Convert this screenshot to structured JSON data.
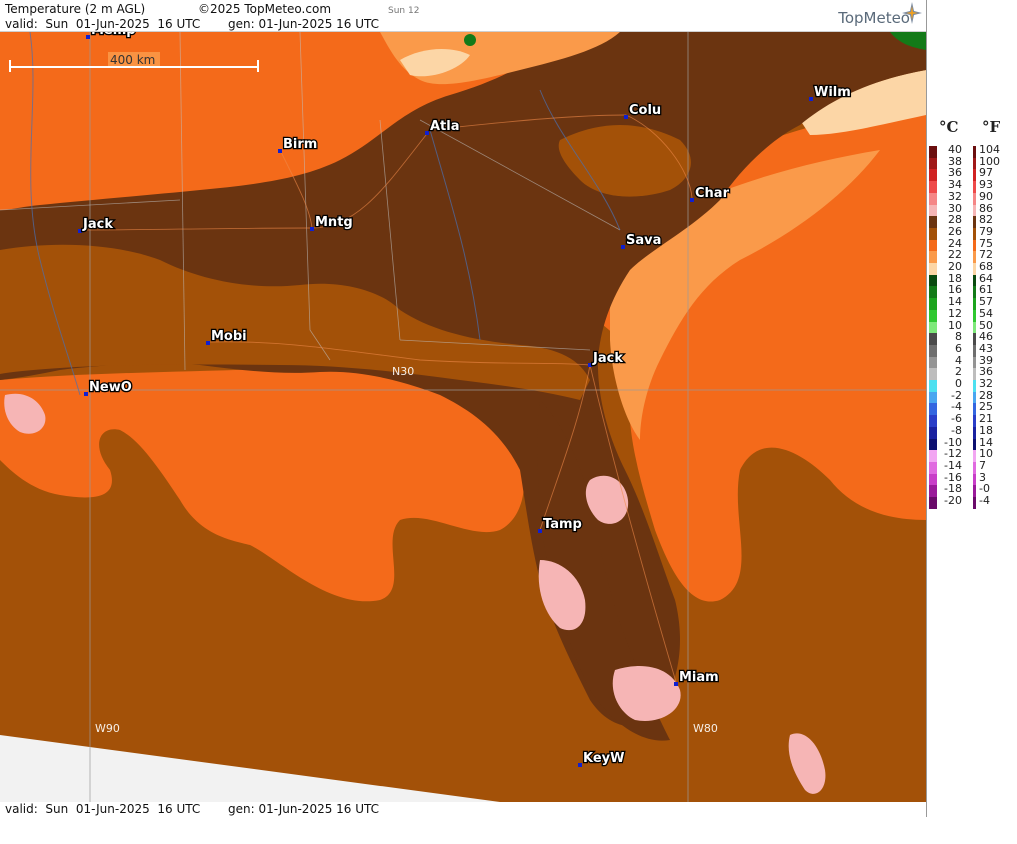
{
  "header": {
    "title": "Temperature (2 m AGL)",
    "copyright": "©2025 TopMeteo.com",
    "day_code": "Sun 12",
    "valid_line": "valid:  Sun  01-Jun-2025  16 UTC",
    "gen_line": "gen: 01-Jun-2025 16 UTC",
    "logo": "TopMeteo"
  },
  "footer": {
    "valid_line": "valid:  Sun  01-Jun-2025  16 UTC",
    "gen_line": "gen: 01-Jun-2025 16 UTC"
  },
  "scale_bar": {
    "label": "400 km"
  },
  "grid_labels": {
    "lat_n30": "N30",
    "lon_w90": "W90",
    "lon_w80": "W80"
  },
  "cities": [
    {
      "id": "memphis",
      "label": "Memp"
    },
    {
      "id": "birmingham",
      "label": "Birm"
    },
    {
      "id": "atlanta",
      "label": "Atla"
    },
    {
      "id": "columbia",
      "label": "Colu"
    },
    {
      "id": "wilmington",
      "label": "Wilm"
    },
    {
      "id": "jackson-ms",
      "label": "Jack"
    },
    {
      "id": "montgomery",
      "label": "Mntg"
    },
    {
      "id": "charleston",
      "label": "Char"
    },
    {
      "id": "savannah",
      "label": "Sava"
    },
    {
      "id": "mobile",
      "label": "Mobi"
    },
    {
      "id": "jacksonville",
      "label": "Jack"
    },
    {
      "id": "new-orleans",
      "label": "NewO"
    },
    {
      "id": "tampa",
      "label": "Tamp"
    },
    {
      "id": "miami",
      "label": "Miam"
    },
    {
      "id": "key-west",
      "label": "KeyW"
    }
  ],
  "legend": {
    "celsius_header": "°C",
    "fahrenheit_header": "°F",
    "rows": [
      {
        "c": "40",
        "f": "104",
        "color": "#6b0f0f"
      },
      {
        "c": "38",
        "f": "100",
        "color": "#a01818"
      },
      {
        "c": "36",
        "f": "97",
        "color": "#d02222"
      },
      {
        "c": "34",
        "f": "93",
        "color": "#ee4a4a"
      },
      {
        "c": "32",
        "f": "90",
        "color": "#f58686"
      },
      {
        "c": "30",
        "f": "86",
        "color": "#f6b5b5"
      },
      {
        "c": "28",
        "f": "82",
        "color": "#6b3410"
      },
      {
        "c": "26",
        "f": "79",
        "color": "#a35108"
      },
      {
        "c": "24",
        "f": "75",
        "color": "#f46a1a"
      },
      {
        "c": "22",
        "f": "72",
        "color": "#fa9a4a"
      },
      {
        "c": "20",
        "f": "68",
        "color": "#fcd6a6"
      },
      {
        "c": "18",
        "f": "64",
        "color": "#0a4a10"
      },
      {
        "c": "16",
        "f": "61",
        "color": "#137a18"
      },
      {
        "c": "14",
        "f": "57",
        "color": "#1ca41e"
      },
      {
        "c": "12",
        "f": "54",
        "color": "#2fc830"
      },
      {
        "c": "10",
        "f": "50",
        "color": "#7ee87a"
      },
      {
        "c": "8",
        "f": "46",
        "color": "#4a4a4a"
      },
      {
        "c": "6",
        "f": "43",
        "color": "#6e6e6e"
      },
      {
        "c": "4",
        "f": "39",
        "color": "#949494"
      },
      {
        "c": "2",
        "f": "36",
        "color": "#bdbdbd"
      },
      {
        "c": "0",
        "f": "32",
        "color": "#4de0f0"
      },
      {
        "c": "-2",
        "f": "28",
        "color": "#4aa6f0"
      },
      {
        "c": "-4",
        "f": "25",
        "color": "#3466e0"
      },
      {
        "c": "-6",
        "f": "21",
        "color": "#2a3ec8"
      },
      {
        "c": "-8",
        "f": "18",
        "color": "#1a22a0"
      },
      {
        "c": "-10",
        "f": "14",
        "color": "#0d1070"
      },
      {
        "c": "-12",
        "f": "10",
        "color": "#f2a6f2"
      },
      {
        "c": "-14",
        "f": "7",
        "color": "#e06ae0"
      },
      {
        "c": "-16",
        "f": "3",
        "color": "#c83ec8"
      },
      {
        "c": "-18",
        "f": "-0",
        "color": "#9a1a9a"
      },
      {
        "c": "-20",
        "f": "-4",
        "color": "#6a0a6a"
      }
    ]
  }
}
